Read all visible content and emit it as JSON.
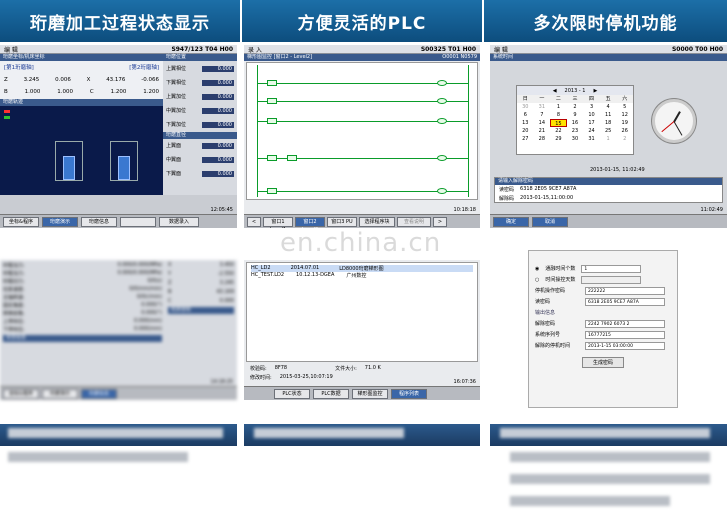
{
  "headers": [
    "珩磨加工过程状态显示",
    "方便灵活的PLC",
    "多次限时停机功能"
  ],
  "panel1": {
    "mode": "编 辑",
    "status": "S947/123 T04 H00",
    "sub": "珩磨坐标/机床坐标",
    "axis_z_label": "Z",
    "axis_z_val": "3.245",
    "axis_z_val2": "0.006",
    "axis_x_label": "X",
    "axis_x_val": "43.176",
    "axis_x_val2": "-0.066",
    "axis_b_label": "B",
    "axis_b_val": "1.000",
    "axis_b_val2": "1.000",
    "axis_c_label": "C",
    "axis_c_val": "1.200",
    "axis_c_val2": "1.200",
    "right_title": "珩磨位置",
    "right_rows": [
      "上翼相位",
      "下翼相位",
      "上翼加位",
      "中翼加位",
      "下翼加位"
    ],
    "right_title2": "珩磨直径",
    "right_rows2": [
      "上翼面",
      "中翼面",
      "下翼面"
    ],
    "trace_title": "珩磨轨迹",
    "time": "12:05:45",
    "softkeys": [
      "坐标&程序",
      "珩磨演示",
      "珩磨信息",
      "",
      "数据录入"
    ]
  },
  "panel2": {
    "mode": "录 入",
    "status": "S00325 T01 H00",
    "sub": "梯形图监控 [窗口2 - Level2]",
    "file": "O0001 N0579",
    "time": "10:18:18",
    "softkeys": [
      "<",
      "窗口1 Level1",
      "窗口2 Level2",
      "窗口3 PU",
      "选择程序块",
      "查看说明",
      ">"
    ]
  },
  "panel3": {
    "mode": "编 辑",
    "status": "S0000 T00 H00",
    "sub": "系统时间",
    "month": "2013 - 1",
    "days_hd": [
      "日",
      "一",
      "二",
      "三",
      "四",
      "五",
      "六"
    ],
    "days": [
      "30",
      "31",
      "1",
      "2",
      "3",
      "4",
      "5",
      "6",
      "7",
      "8",
      "9",
      "10",
      "11",
      "12",
      "13",
      "14",
      "15",
      "16",
      "17",
      "18",
      "19",
      "20",
      "21",
      "22",
      "23",
      "24",
      "25",
      "26",
      "27",
      "28",
      "29",
      "30",
      "31",
      "1",
      "2"
    ],
    "datetime": "2013-01-15, 11:02:49",
    "unlock_title": "请输入解除密码",
    "code_label": "读密码",
    "code_val": "6318 2E05 9CE7 A87A",
    "unlock_label": "解除码",
    "unlock_val": "2013-01-15,11:00:00",
    "softkeys": [
      "确定",
      "取消"
    ],
    "time": "11:02:49"
  },
  "bottom": {
    "p4_rows": [
      "珩程当力:",
      "珩程当力:",
      "珩程切力:",
      "往复速度:",
      "主轴转速:",
      "固定角度:",
      "转换前角:",
      "上停向位:",
      "下停向位:"
    ],
    "p4_vals": [
      "0.000/0.000(MPa)",
      "0.000/0.000(MPa)",
      "0/0(s)",
      "0/0(mm/min)",
      "0/0(r/min)",
      "0.000(°)",
      "0.000(°)",
      "0.000(mm)",
      "0.000(mm)"
    ],
    "p4_axes": [
      "X",
      "Y",
      "Z",
      "B",
      "C"
    ],
    "p4_axvals": [
      "3.450",
      "-2.550",
      "3.245",
      "43.169",
      "0.000",
      "1.000",
      "1.200"
    ],
    "p4_state": "状态信息",
    "p4_machine": "机床坐标",
    "p4_time": "14:18:25",
    "p4_softkeys": [
      "坐标&程序",
      "珩磨演示",
      "珩磨信息"
    ],
    "p5_file1": "HC_LD2",
    "p5_file1_date": "2014.07.01",
    "p5_file1_desc": "LD8000珩磨梯形图",
    "p5_file2": "HC_TEST.LD2",
    "p5_file2_date": "10.12.13-DGEA",
    "p5_file2_desc": "广州数控",
    "p5_check_label": "校验码:",
    "p5_check_val": "8F78",
    "p5_size_label": "文件大小:",
    "p5_size_val": "71.0 K",
    "p5_mod_label": "修改时间:",
    "p5_mod_val": "2015-03-25,10:07:19",
    "p5_time": "16:07:36",
    "p5_softkeys": [
      "PLC状态",
      "PLC数据",
      "梯形图监控",
      "程序列表"
    ],
    "dlg_opt1": "通融时间个数",
    "dlg_opt1_val": "1",
    "dlg_opt2": "时间操控天数",
    "dlg_pw_label": "停机操作密码",
    "dlg_pw_val": "222222",
    "dlg_read_label": "读密码",
    "dlg_read_val": "6318 2E05 9CE7 A87A",
    "dlg_out_title": "输出信息",
    "dlg_unlock_label": "解除密码",
    "dlg_unlock_val": "2242 7902 6073 2",
    "dlg_serial_label": "系统序列号",
    "dlg_serial_val": "16777215",
    "dlg_time_label": "解除的停机时间",
    "dlg_time_val": "2013-1-15 03:00:00",
    "dlg_button": "生成密码"
  },
  "watermark": "en.china.cn"
}
